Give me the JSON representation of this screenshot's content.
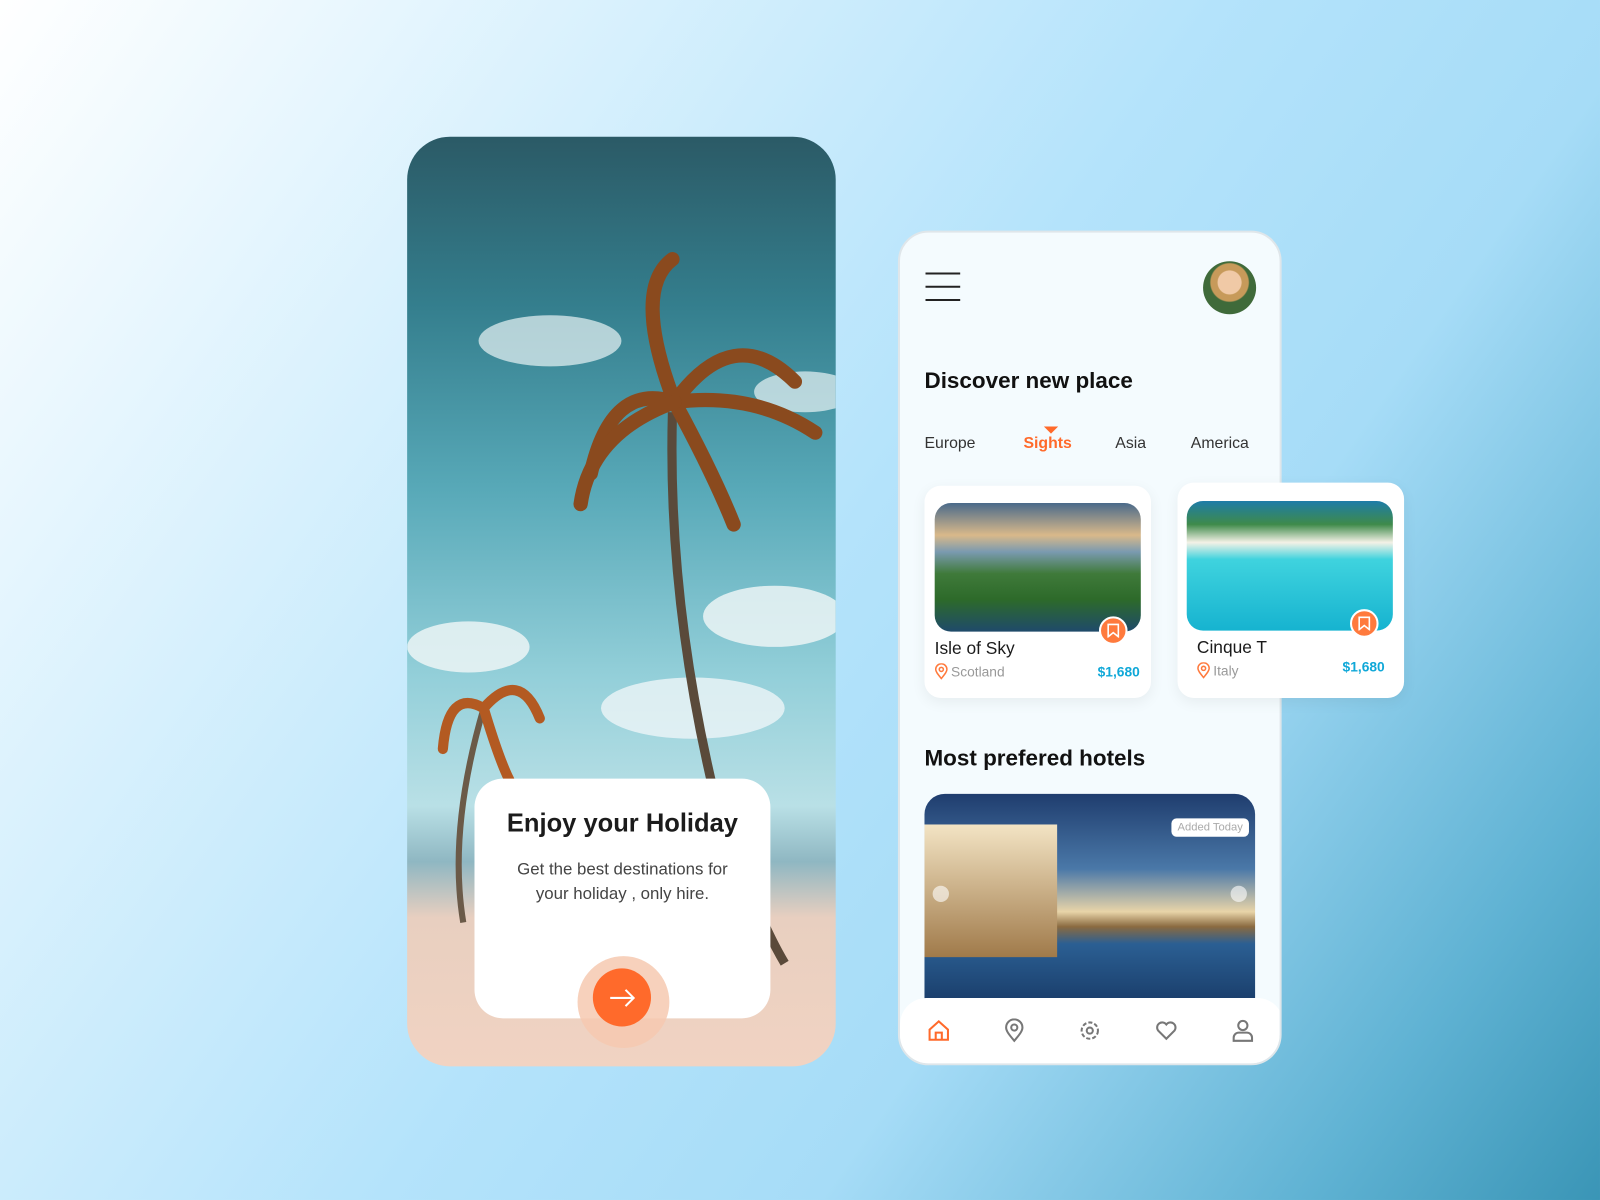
{
  "welcome": {
    "title": "Enjoy your Holiday",
    "subtitle": "Get the best destinations for your holiday , only hire.",
    "next_icon": "arrow-right-icon"
  },
  "home": {
    "menu_icon": "hamburger-icon",
    "title": "Discover new place",
    "tabs": [
      {
        "label": "Europe"
      },
      {
        "label": "Sights",
        "active": true
      },
      {
        "label": "Asia"
      },
      {
        "label": "America"
      }
    ],
    "places": [
      {
        "name": "Isle of Sky",
        "location": "Scotland",
        "price": "$1,680"
      },
      {
        "name": "Cinque T",
        "location": "Italy",
        "price": "$1,680"
      }
    ],
    "hotels_title": "Most prefered hotels",
    "hotel_badge": "Added Today",
    "nav": [
      "home-icon",
      "map-pin-icon",
      "gear-icon",
      "heart-icon",
      "user-icon"
    ]
  },
  "colors": {
    "accent": "#ff6a2b",
    "price": "#10a8d8"
  }
}
